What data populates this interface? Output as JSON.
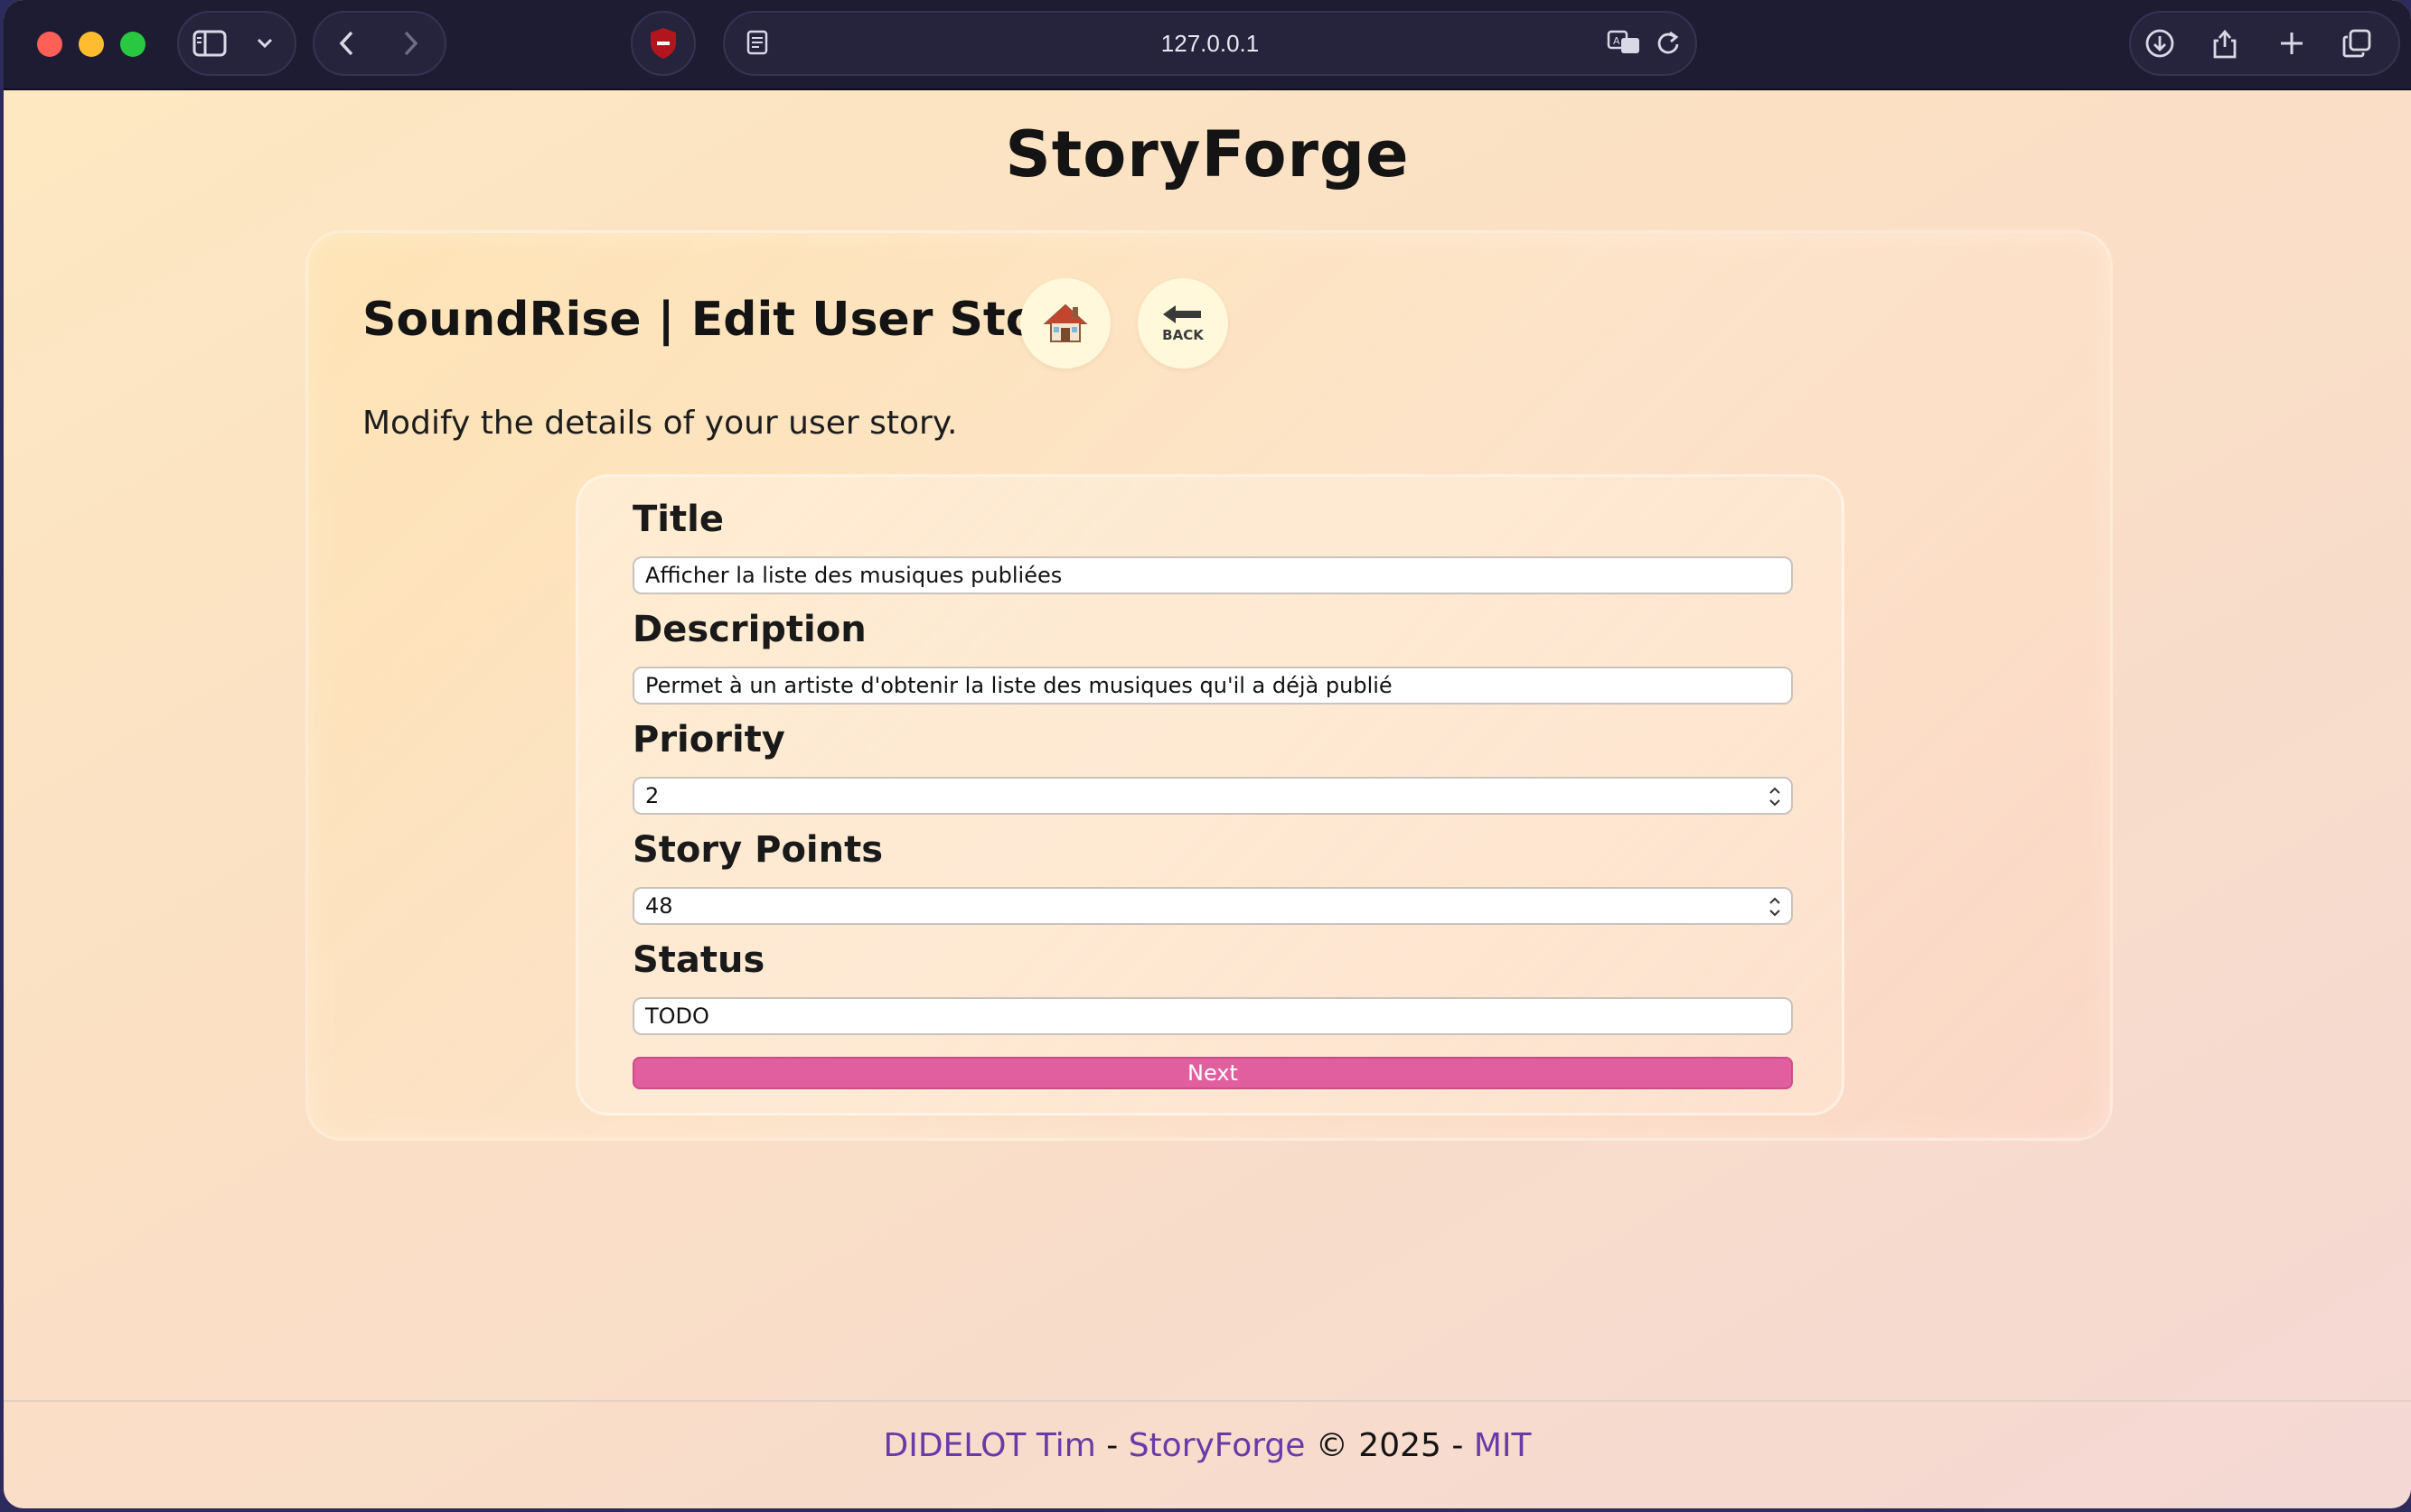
{
  "browser": {
    "url": "127.0.0.1"
  },
  "page": {
    "site_title": "StoryForge",
    "heading": "SoundRise | Edit User Story",
    "subtitle": "Modify the details of your user story.",
    "home_icon": "house-emoji",
    "back_icon": "back-arrow-emoji",
    "back_label": "BACK"
  },
  "form": {
    "title_label": "Title",
    "title_value": "Afficher la liste des musiques publiées",
    "description_label": "Description",
    "description_value": "Permet à un artiste d'obtenir la liste des musiques qu'il a déjà publié",
    "priority_label": "Priority",
    "priority_value": "2",
    "story_points_label": "Story Points",
    "story_points_value": "48",
    "status_label": "Status",
    "status_value": "TODO",
    "next_label": "Next"
  },
  "footer": {
    "author": "DIDELOT Tim",
    "sep1": " - ",
    "project": "StoryForge",
    "copyright": " © 2025 - ",
    "license": "MIT"
  },
  "colors": {
    "accent_button": "#e25f9f",
    "link": "#6a3aa8"
  }
}
